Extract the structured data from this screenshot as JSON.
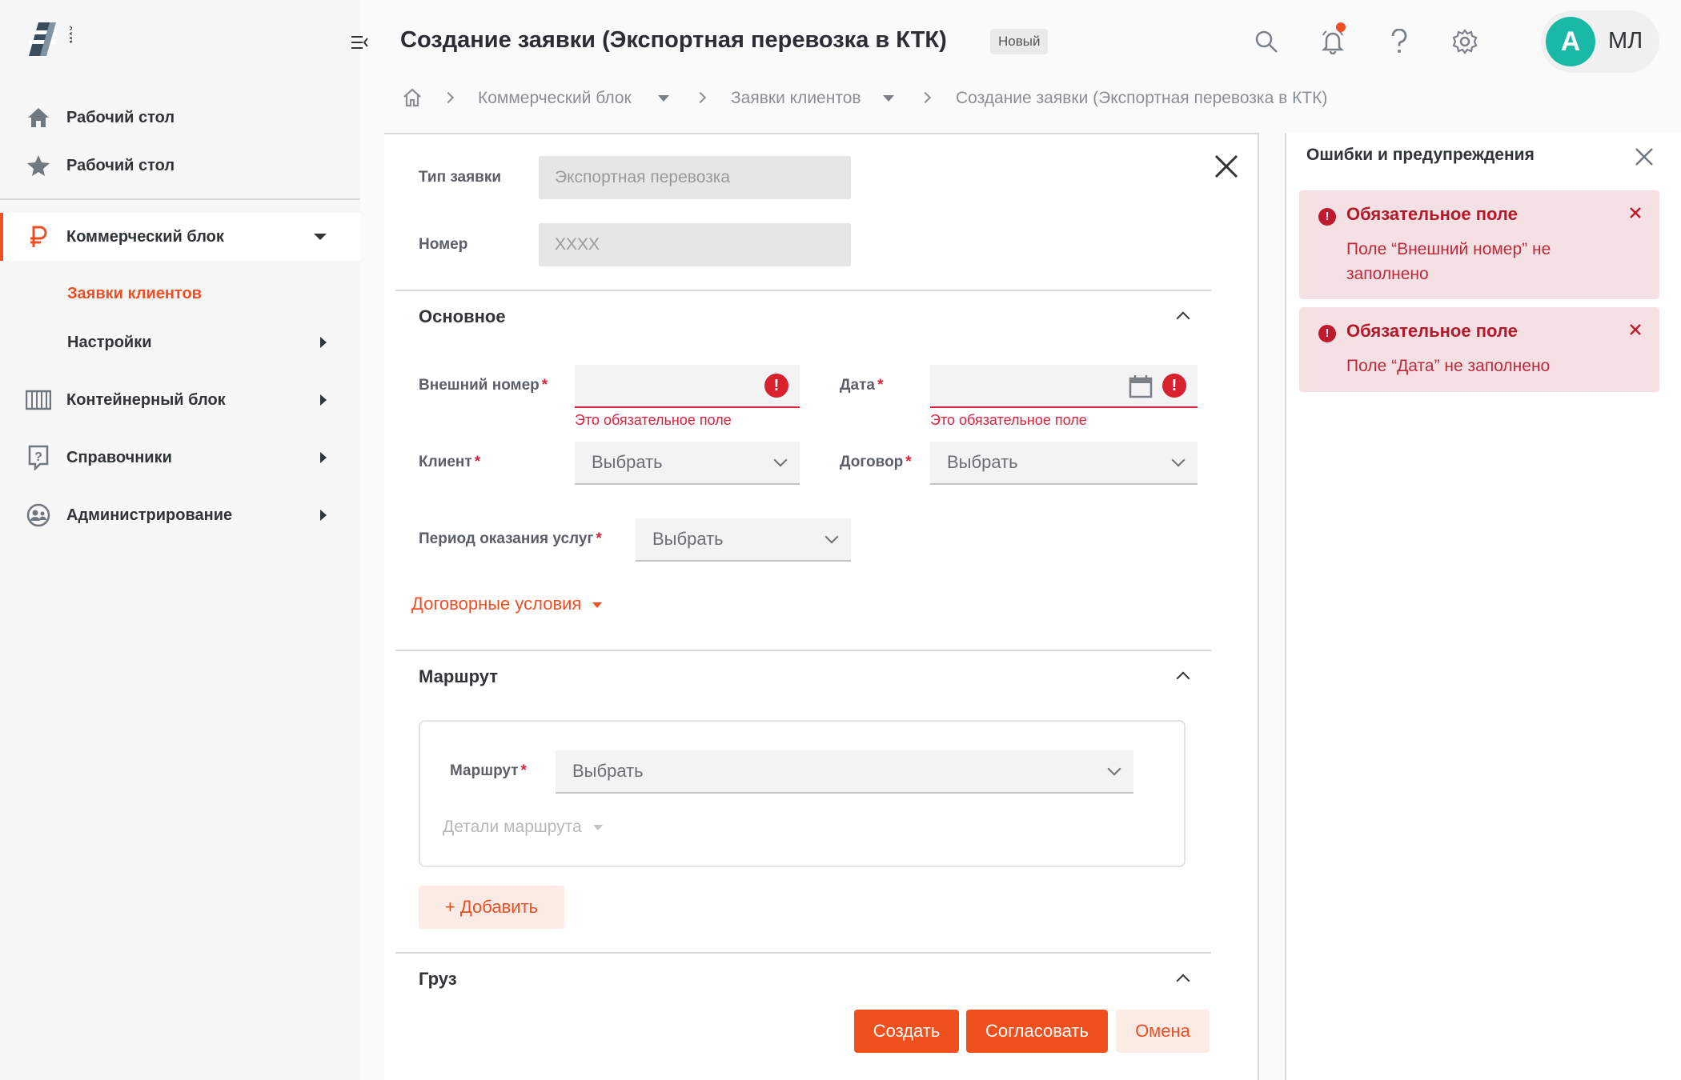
{
  "sidebar": {
    "items": [
      {
        "label": "Рабочий стол",
        "icon": "home-icon"
      },
      {
        "label": "Рабочий стол",
        "icon": "star-icon"
      },
      {
        "label": "Коммерческий блок",
        "icon": "ruble-icon"
      },
      {
        "label": "Контейнерный блок",
        "icon": "container-icon"
      },
      {
        "label": "Справочники",
        "icon": "help-book-icon"
      },
      {
        "label": "Администрирование",
        "icon": "admin-icon"
      }
    ],
    "subitems": [
      {
        "label": "Заявки клиентов"
      },
      {
        "label": "Настройки"
      }
    ]
  },
  "header": {
    "title": "Создание заявки (Экспортная перевозка в КТК)",
    "status": "Новый",
    "user": {
      "avatar_letter": "A",
      "initials": "МЛ"
    }
  },
  "breadcrumb": {
    "items": [
      "Коммерческий блок",
      "Заявки клиентов",
      "Создание заявки (Экспортная перевозка в КТК)"
    ]
  },
  "form": {
    "type_label": "Тип заявки",
    "type_value": "Экспортная перевозка",
    "number_label": "Номер",
    "number_value": "XXXX",
    "section_main": "Основное",
    "external_number_label": "Внешний номер",
    "date_label": "Дата",
    "required_error": "Это обязательное поле",
    "client_label": "Клиент",
    "contract_label": "Договор",
    "select_placeholder": "Выбрать",
    "period_label": "Период оказания услуг",
    "contract_terms_link": "Договорные условия",
    "section_route": "Маршрут",
    "route_label": "Маршрут",
    "route_details_link": "Детали маршрута",
    "add_button": "+ Добавить",
    "section_cargo": "Груз",
    "create_button": "Создать",
    "approve_button": "Согласовать",
    "cancel_button": "Омена",
    "required_mark": "*"
  },
  "errors_panel": {
    "title": "Ошибки и предупреждения",
    "items": [
      {
        "title": "Обязательное поле",
        "text": "Поле “Внешний номер” не заполнено"
      },
      {
        "title": "Обязательное поле",
        "text": "Поле “Дата” не заполнено"
      }
    ]
  },
  "colors": {
    "accent": "#f04e23",
    "error": "#e0203a",
    "avatar": "#1ab8a6"
  }
}
